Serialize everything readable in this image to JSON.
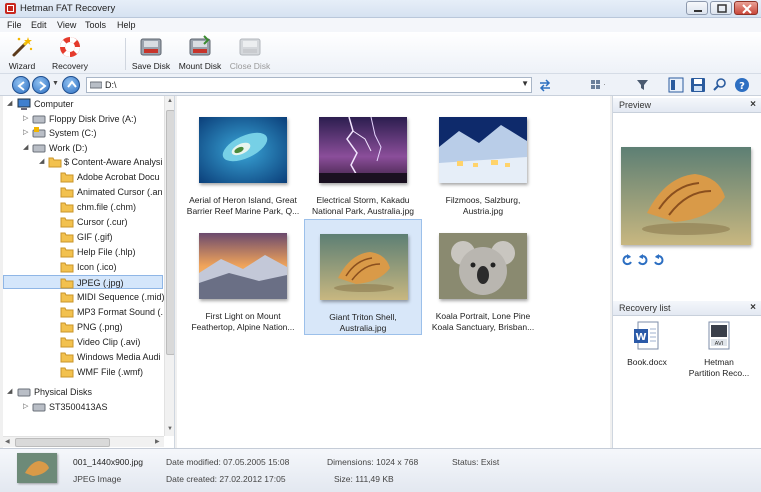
{
  "window": {
    "title": "Hetman FAT Recovery"
  },
  "menu": [
    "File",
    "Edit",
    "View",
    "Tools",
    "Help"
  ],
  "toolbar": {
    "wizard": "Wizard",
    "recovery": "Recovery",
    "save_disk": "Save Disk",
    "mount_disk": "Mount Disk",
    "close_disk": "Close Disk"
  },
  "address": {
    "path": "D:\\"
  },
  "tree": {
    "computer": "Computer",
    "floppy": "Floppy Disk Drive (A:)",
    "system": "System (C:)",
    "work": "Work (D:)",
    "content_aware": "$ Content-Aware Analysi",
    "folders": [
      "Adobe Acrobat Docu",
      "Animated Cursor (.an",
      "chm.file (.chm)",
      "Cursor (.cur)",
      "GIF (.gif)",
      "Help File (.hlp)",
      "Icon (.ico)",
      "JPEG (.jpg)",
      "MIDI Sequence (.mid)",
      "MP3 Format Sound (.",
      "PNG (.png)",
      "Video Clip (.avi)",
      "Windows Media Audi",
      "WMF File (.wmf)"
    ],
    "physical_disks": "Physical Disks",
    "disk": "ST3500413AS"
  },
  "files": [
    {
      "l1": "Aerial of Heron Island, Great",
      "l2": "Barrier Reef Marine Park, Q..."
    },
    {
      "l1": "Electrical Storm, Kakadu",
      "l2": "National Park, Australia.jpg"
    },
    {
      "l1": "Filzmoos, Salzburg,",
      "l2": "Austria.jpg"
    },
    {
      "l1": "First Light on Mount",
      "l2": "Feathertop, Alpine Nation..."
    },
    {
      "l1": "Giant Triton Shell,",
      "l2": "Australia.jpg"
    },
    {
      "l1": "Koala Portrait, Lone Pine",
      "l2": "Koala Sanctuary, Brisban..."
    }
  ],
  "preview": {
    "title": "Preview"
  },
  "recovery_list": {
    "title": "Recovery list",
    "items": [
      {
        "l1": "Book.docx",
        "l2": ""
      },
      {
        "l1": "Hetman",
        "l2": "Partition Reco..."
      }
    ]
  },
  "status": {
    "filename": "001_1440x900.jpg",
    "filetype": "JPEG Image",
    "modified": "Date modified: 07.05.2005 15:08",
    "created": "Date created: 27.02.2012 17:05",
    "dimensions": "Dimensions: 1024 x 768",
    "size": "Size: 111,49 KB",
    "state": "Status: Exist"
  }
}
